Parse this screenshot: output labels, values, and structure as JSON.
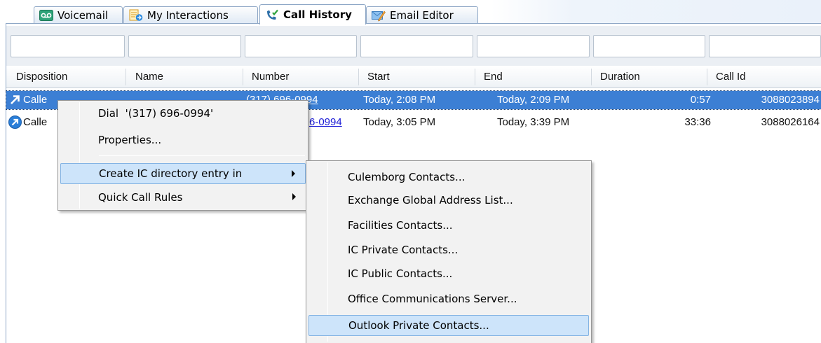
{
  "tabs": [
    {
      "label": "Voicemail",
      "icon": "voicemail-icon"
    },
    {
      "label": "My Interactions",
      "icon": "interactions-icon"
    },
    {
      "label": "Call History",
      "icon": "call-history-icon",
      "active": true
    },
    {
      "label": "Email Editor",
      "icon": "email-editor-icon"
    }
  ],
  "columns": [
    "Disposition",
    "Name",
    "Number",
    "Start",
    "End",
    "Duration",
    "Call Id"
  ],
  "rows": [
    {
      "disposition": "Calle",
      "name": "",
      "number": "(317) 696-0994",
      "start": "Today, 2:08 PM",
      "end": "Today, 2:09 PM",
      "duration": "0:57",
      "call_id": "3088023894",
      "selected": true
    },
    {
      "disposition": "Calle",
      "name": "",
      "number": "6-0994",
      "start": "Today, 3:05 PM",
      "end": "Today, 3:39 PM",
      "duration": "33:36",
      "call_id": "3088026164",
      "selected": false
    }
  ],
  "context_menu": {
    "items": [
      {
        "label": "Dial  '(317) 696-0994'"
      },
      {
        "label": "Properties..."
      },
      {
        "label": "Create IC directory entry in",
        "submenu": true,
        "hover": true
      },
      {
        "label": "Quick Call Rules",
        "submenu": true
      }
    ]
  },
  "submenu": {
    "items": [
      {
        "label": "Culemborg Contacts..."
      },
      {
        "label": "Exchange Global Address List..."
      },
      {
        "label": "Facilities Contacts..."
      },
      {
        "label": "IC Private Contacts..."
      },
      {
        "label": "IC Public Contacts..."
      },
      {
        "label": "Office Communications Server..."
      },
      {
        "label": "Outlook Private Contacts...",
        "hover": true
      }
    ]
  },
  "colors": {
    "selection": "#3c7fd4",
    "menu_hover": "#cde4fa",
    "link": "#1a1ad6",
    "voicemail_icon": "#2fa37a",
    "call_icon": "#2a7ed8"
  }
}
